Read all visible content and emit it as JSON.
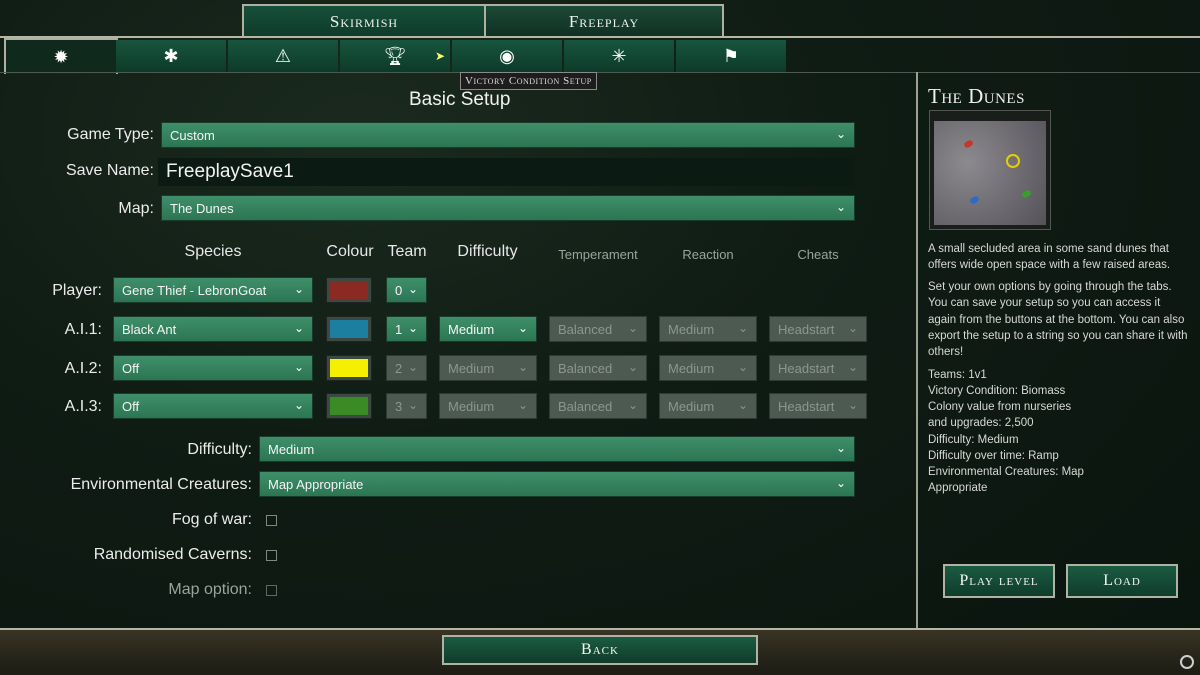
{
  "mode_tabs": [
    "Skirmish",
    "Freeplay"
  ],
  "icon_tabs": [
    "gear-icon",
    "ant-icon",
    "warning-icon",
    "trophy-icon",
    "globe-icon",
    "spider-icon",
    "flag-icon"
  ],
  "tooltip": "Victory Condition Setup",
  "basic_setup": {
    "title": "Basic Setup",
    "game_type_label": "Game Type:",
    "game_type_value": "Custom",
    "save_name_label": "Save Name:",
    "save_name_value": "FreeplaySave1",
    "map_label": "Map:",
    "map_value": "The Dunes"
  },
  "columns": {
    "species": "Species",
    "colour": "Colour",
    "team": "Team",
    "difficulty": "Difficulty",
    "temperament": "Temperament",
    "reaction": "Reaction",
    "cheats": "Cheats"
  },
  "rows": [
    {
      "label": "Player:",
      "species": "Gene Thief - LebronGoat",
      "colour": "#8b2a22",
      "team": "0"
    },
    {
      "label": "A.I.1:",
      "species": "Black Ant",
      "colour": "#1d7fa0",
      "team": "1",
      "difficulty": "Medium",
      "temperament": "Balanced",
      "reaction": "Medium",
      "cheats": "Headstart"
    },
    {
      "label": "A.I.2:",
      "species": "Off",
      "colour": "#f5f000",
      "team": "2",
      "difficulty": "Medium",
      "temperament": "Balanced",
      "reaction": "Medium",
      "cheats": "Headstart"
    },
    {
      "label": "A.I.3:",
      "species": "Off",
      "colour": "#3a8a26",
      "team": "3",
      "difficulty": "Medium",
      "temperament": "Balanced",
      "reaction": "Medium",
      "cheats": "Headstart"
    }
  ],
  "difficulty_label": "Difficulty:",
  "difficulty_value": "Medium",
  "env_label": "Environmental Creatures:",
  "env_value": "Map Appropriate",
  "fog_label": "Fog of war:",
  "caverns_label": "Randomised Caverns:",
  "map_option_label": "Map option:",
  "side": {
    "title": "The Dunes",
    "desc": "A small secluded area in some sand dunes that offers wide open space with a few raised areas.",
    "help": "Set your own options by going through the tabs. You can save your setup so you can access it again from the buttons at the bottom. You can also export the setup to a string so you can share it with others!",
    "teams": "Teams: 1v1",
    "victory": "Victory Condition: Biomass",
    "colony": "Colony value from nurseries and upgrades: 2,500",
    "difficulty": "Difficulty: Medium",
    "difficulty_time": "Difficulty over time: Ramp",
    "env": "Environmental Creatures: Map Appropriate",
    "play_label": "Play level",
    "load_label": "Load"
  },
  "back_label": "Back",
  "colors": {
    "accent": "#2c7553",
    "panel": "#0d1a12",
    "border": "#b0b2a2"
  }
}
